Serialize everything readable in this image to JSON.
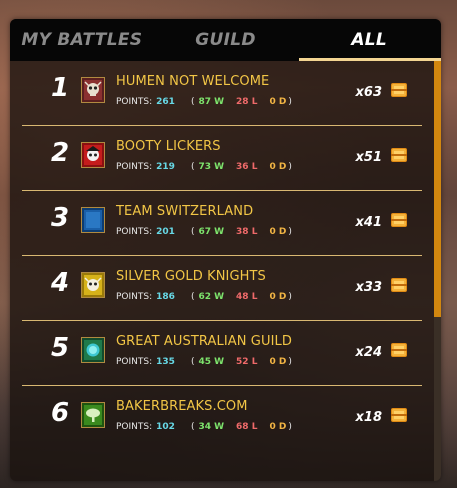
{
  "tabs": [
    {
      "label": "MY BATTLES",
      "active": false
    },
    {
      "label": "GUILD",
      "active": false
    },
    {
      "label": "ALL",
      "active": true
    }
  ],
  "points_label": "POINTS:",
  "guilds": [
    {
      "rank": "1",
      "name": "HUMEN NOT WELCOME",
      "points": "261",
      "wins": "87 W",
      "losses": "28 L",
      "draws": "0 D",
      "multiplier": "x63",
      "crest": "skull-crest-icon",
      "crest_color": "#7a2a2a"
    },
    {
      "rank": "2",
      "name": "BOOTY LICKERS",
      "points": "219",
      "wins": "73 W",
      "losses": "36 L",
      "draws": "0 D",
      "multiplier": "x51",
      "crest": "pirate-crest-icon",
      "crest_color": "#b01818"
    },
    {
      "rank": "3",
      "name": "TEAM SWITZERLAND",
      "points": "201",
      "wins": "67 W",
      "losses": "38 L",
      "draws": "0 D",
      "multiplier": "x41",
      "crest": "blue-banner-icon",
      "crest_color": "#1a5fa8"
    },
    {
      "rank": "4",
      "name": "SILVER GOLD KNIGHTS",
      "points": "186",
      "wins": "62 W",
      "losses": "48 L",
      "draws": "0 D",
      "multiplier": "x33",
      "crest": "knight-skull-crest-icon",
      "crest_color": "#d6b21a"
    },
    {
      "rank": "5",
      "name": "GREAT AUSTRALIAN GUILD",
      "points": "135",
      "wins": "45 W",
      "losses": "52 L",
      "draws": "0 D",
      "multiplier": "x24",
      "crest": "orb-crest-icon",
      "crest_color": "#1f7a4a"
    },
    {
      "rank": "6",
      "name": "BAKERBREAKS.COM",
      "points": "102",
      "wins": "34 W",
      "losses": "68 L",
      "draws": "0 D",
      "multiplier": "x18",
      "crest": "tree-crest-icon",
      "crest_color": "#3a8a1e"
    }
  ],
  "reward_icon": "treasure-chest-icon",
  "colors": {
    "accent": "#f3d592",
    "name": "#f2c646",
    "points": "#67d8e6",
    "wins": "#7de36c",
    "losses": "#ef6a6a",
    "draws": "#f2b544",
    "scroll": "#d2870f"
  }
}
